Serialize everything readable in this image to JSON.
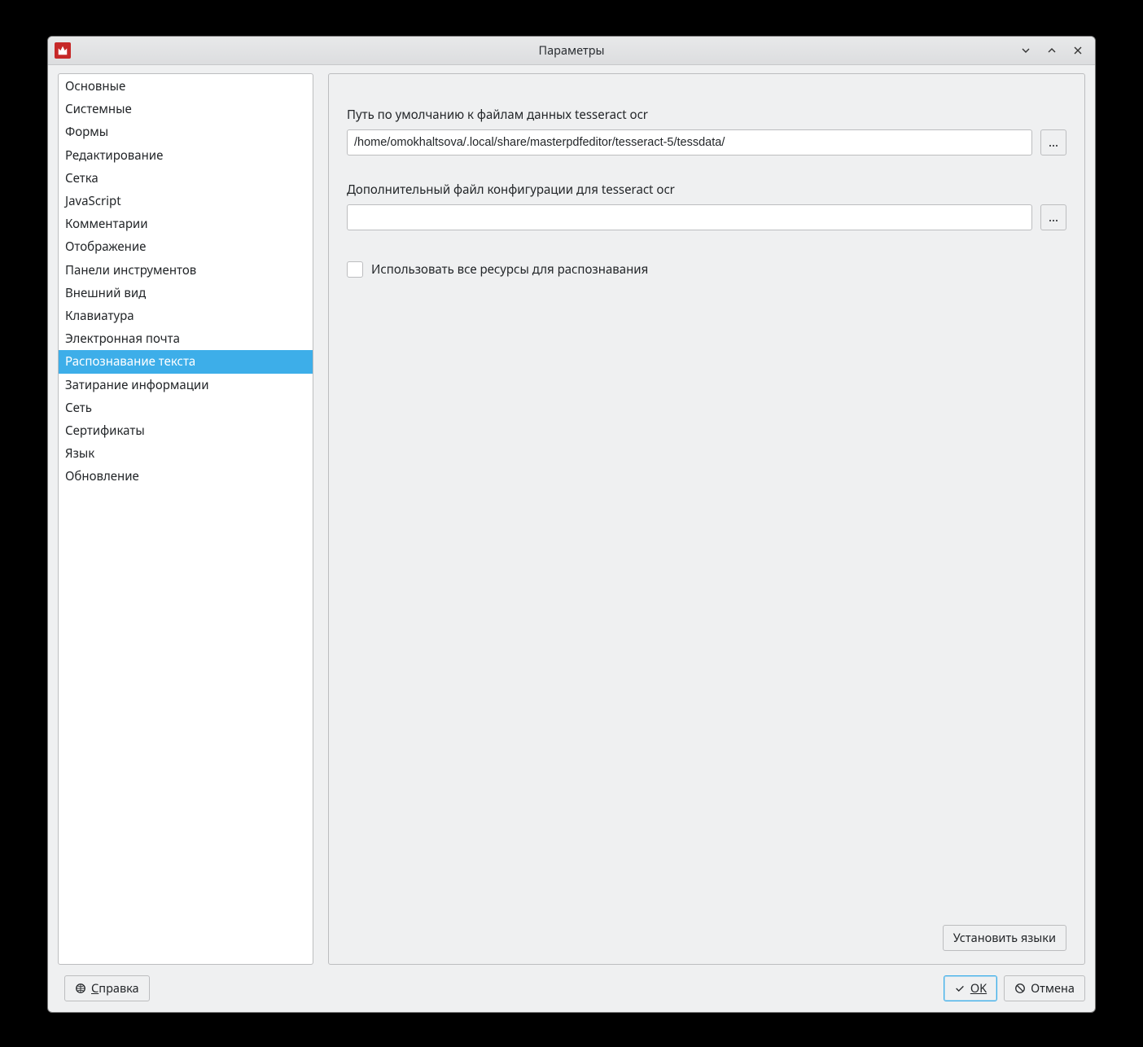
{
  "window": {
    "title": "Параметры"
  },
  "sidebar": {
    "items": [
      {
        "label": "Основные"
      },
      {
        "label": "Системные"
      },
      {
        "label": "Формы"
      },
      {
        "label": "Редактирование"
      },
      {
        "label": "Сетка"
      },
      {
        "label": "JavaScript"
      },
      {
        "label": "Комментарии"
      },
      {
        "label": "Отображение"
      },
      {
        "label": "Панели инструментов"
      },
      {
        "label": "Внешний вид"
      },
      {
        "label": "Клавиатура"
      },
      {
        "label": "Электронная почта"
      },
      {
        "label": "Распознавание текста"
      },
      {
        "label": "Затирание информации"
      },
      {
        "label": "Сеть"
      },
      {
        "label": "Сертификаты"
      },
      {
        "label": "Язык"
      },
      {
        "label": "Обновление"
      }
    ],
    "selected_index": 12
  },
  "form": {
    "tessdata_path_label": "Путь по умолчанию к файлам данных tesseract ocr",
    "tessdata_path_value": "/home/omokhaltsova/.local/share/masterpdfeditor/tesseract-5/tessdata/",
    "tess_config_label": "Дополнительный файл конфигурации для tesseract ocr",
    "tess_config_value": "",
    "browse_label": "...",
    "use_all_resources_label": "Использовать все ресурсы для распознавания",
    "use_all_resources_checked": false,
    "install_langs_label": "Установить языки"
  },
  "buttons": {
    "help": "Справка",
    "ok": "OK",
    "cancel": "Отмена"
  }
}
